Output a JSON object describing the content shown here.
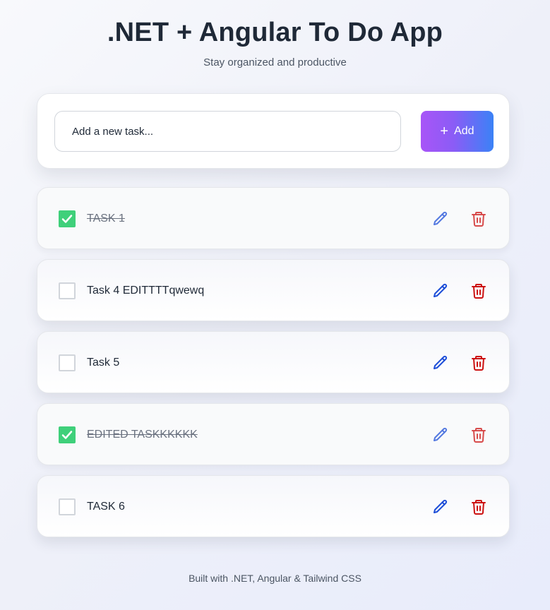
{
  "header": {
    "title": ".NET + Angular To Do App",
    "subtitle": "Stay organized and productive"
  },
  "add_form": {
    "placeholder": "Add a new task...",
    "value": "",
    "button_label": "Add",
    "button_icon": "plus-icon"
  },
  "tasks": [
    {
      "title": "TASK 1",
      "completed": true,
      "edit_icon": "pencil-icon",
      "delete_icon": "trash-icon"
    },
    {
      "title": "Task 4 EDITTTTqwewq",
      "completed": false,
      "edit_icon": "pencil-icon",
      "delete_icon": "trash-icon"
    },
    {
      "title": "Task 5",
      "completed": false,
      "edit_icon": "pencil-icon",
      "delete_icon": "trash-icon"
    },
    {
      "title": "EDITED TASKKKKKK",
      "completed": true,
      "edit_icon": "pencil-icon",
      "delete_icon": "trash-icon"
    },
    {
      "title": "TASK 6",
      "completed": false,
      "edit_icon": "pencil-icon",
      "delete_icon": "trash-icon"
    }
  ],
  "footer": {
    "text": "Built with .NET, Angular & Tailwind CSS"
  },
  "colors": {
    "check_green": "#3fd07a",
    "edit_blue": "#1d4ed8",
    "delete_red": "#cc1111",
    "button_gradient_start": "#a855f7",
    "button_gradient_end": "#3b82f6"
  }
}
